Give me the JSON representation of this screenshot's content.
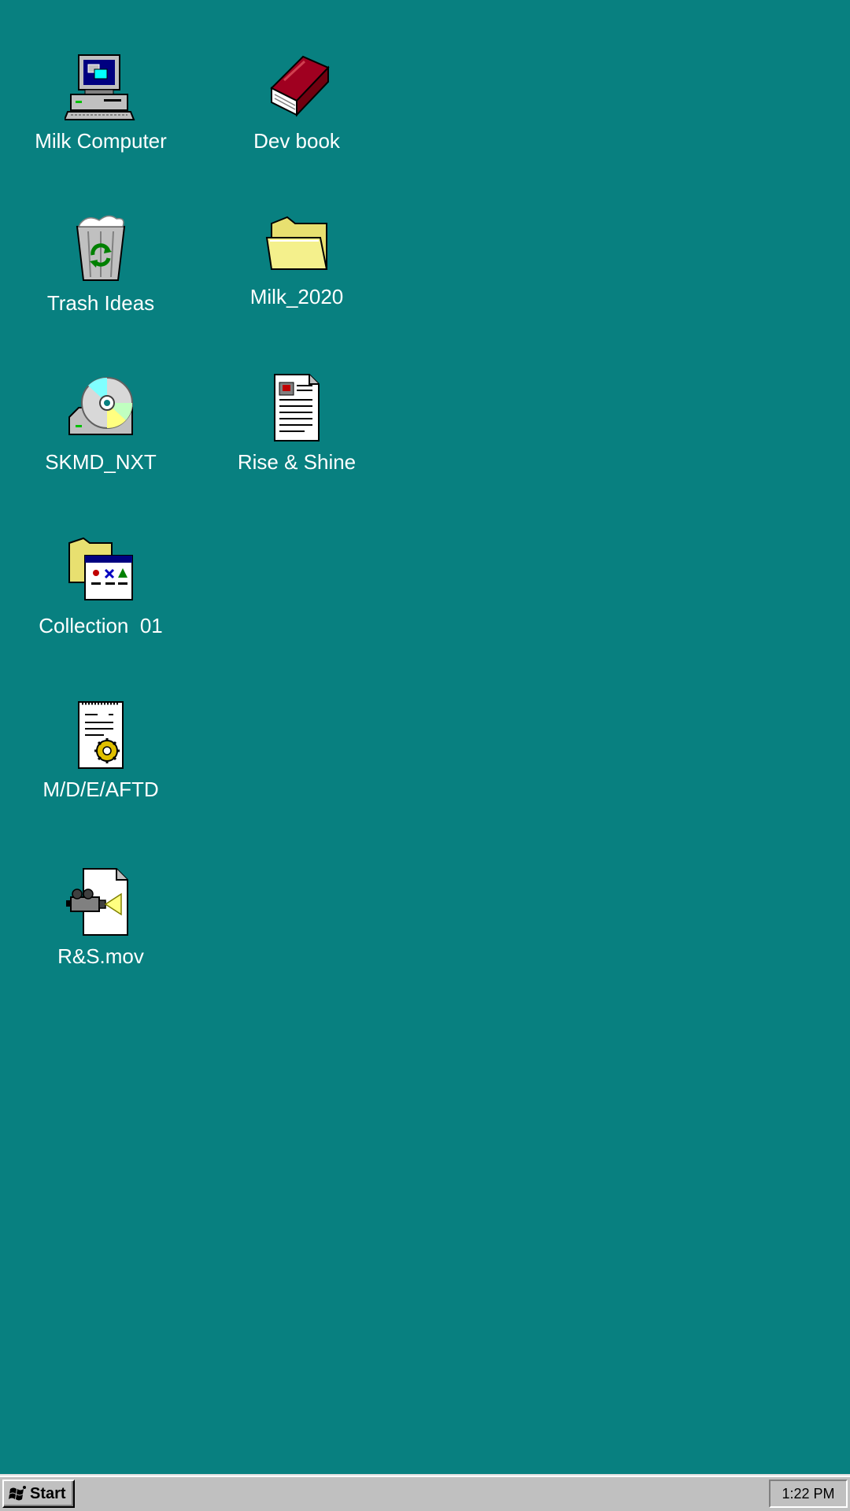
{
  "desktop": {
    "background_color": "#088080",
    "icons": [
      {
        "label": "Milk Computer",
        "icon": "computer-icon"
      },
      {
        "label": "Dev book",
        "icon": "book-icon"
      },
      {
        "label": "Trash Ideas",
        "icon": "recycle-bin-icon"
      },
      {
        "label": "Milk_2020",
        "icon": "folder-icon"
      },
      {
        "label": "SKMD_NXT",
        "icon": "cd-drive-icon"
      },
      {
        "label": "Rise & Shine",
        "icon": "document-icon"
      },
      {
        "label": "Collection  01",
        "icon": "program-group-icon"
      },
      {
        "label": "M/D/E/AFTD",
        "icon": "settings-document-icon"
      },
      {
        "label": "R&S.mov",
        "icon": "video-file-icon"
      }
    ]
  },
  "taskbar": {
    "start_label": "Start",
    "start_icon": "windows-logo-icon",
    "clock": "1:22 PM"
  }
}
